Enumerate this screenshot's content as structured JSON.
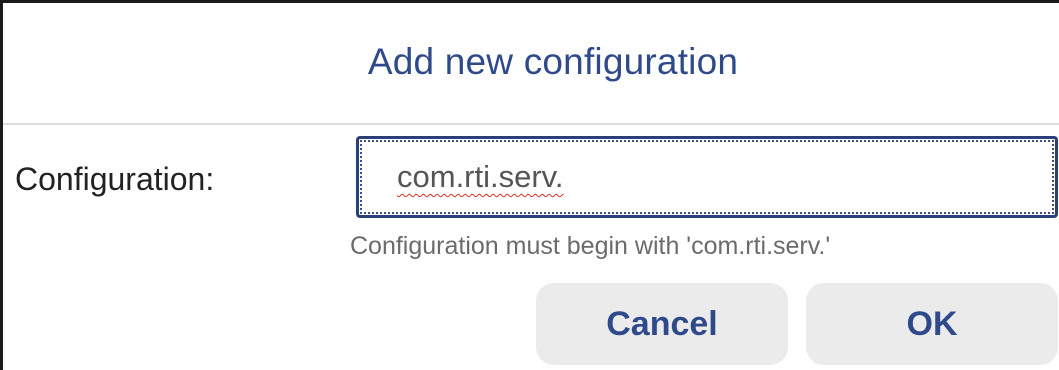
{
  "dialog": {
    "title": "Add new configuration",
    "field": {
      "label": "Configuration:",
      "value": "com.rti.serv.",
      "helper": "Configuration must begin with 'com.rti.serv.'"
    },
    "buttons": {
      "cancel_label": "Cancel",
      "ok_label": "OK"
    }
  },
  "colors": {
    "title": "#2f4a8a",
    "button_bg": "#ebebeb",
    "input_border": "#2b3f7a",
    "spellcheck_underline": "#d93025"
  }
}
